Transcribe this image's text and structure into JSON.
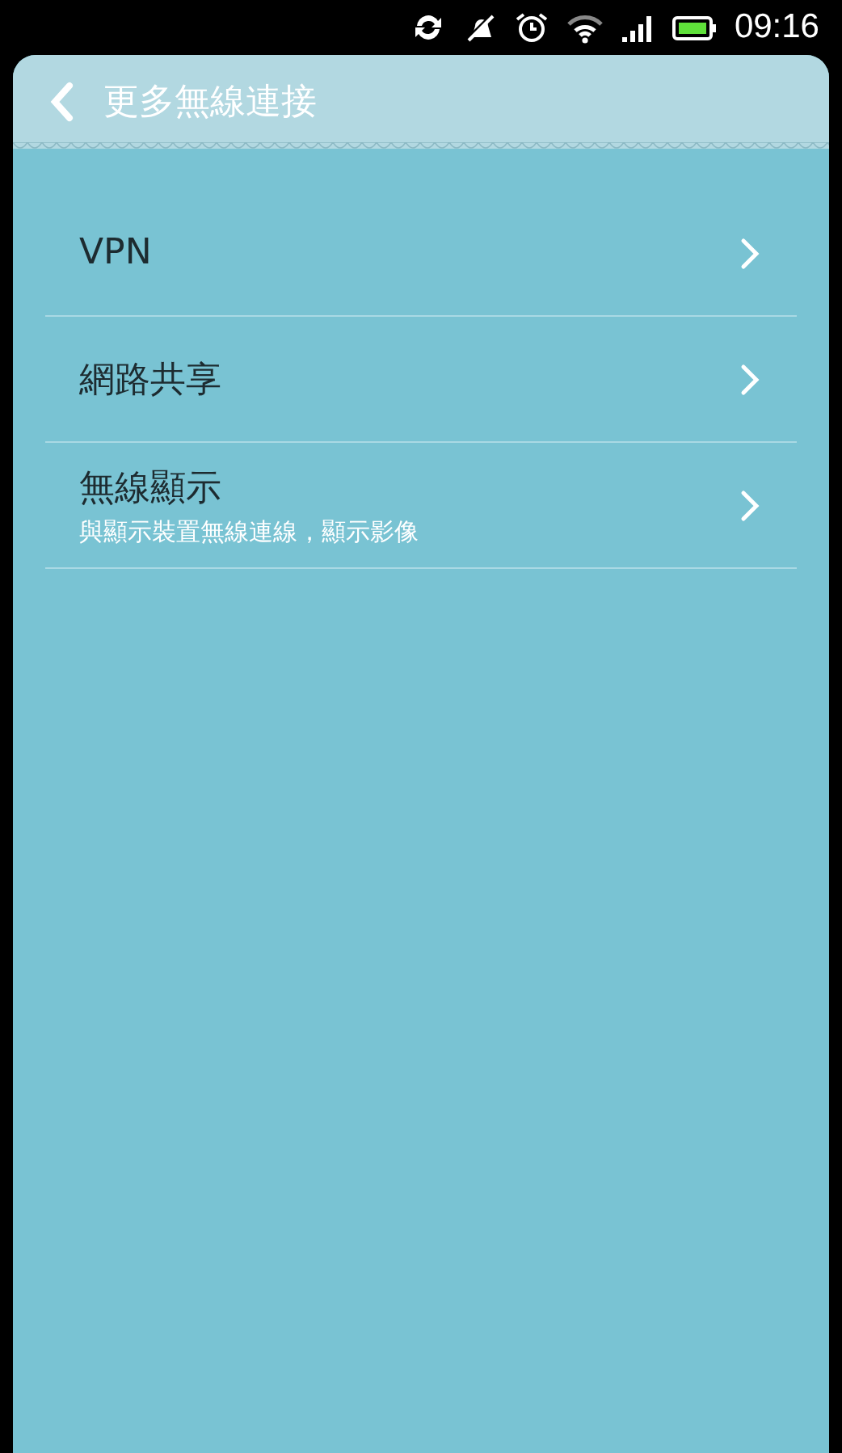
{
  "status_bar": {
    "time": "09:16"
  },
  "header": {
    "title": "更多無線連接"
  },
  "items": [
    {
      "title": "VPN"
    },
    {
      "title": "網路共享"
    },
    {
      "title": "無線顯示",
      "subtitle": "與顯示裝置無線連線，顯示影像"
    }
  ]
}
